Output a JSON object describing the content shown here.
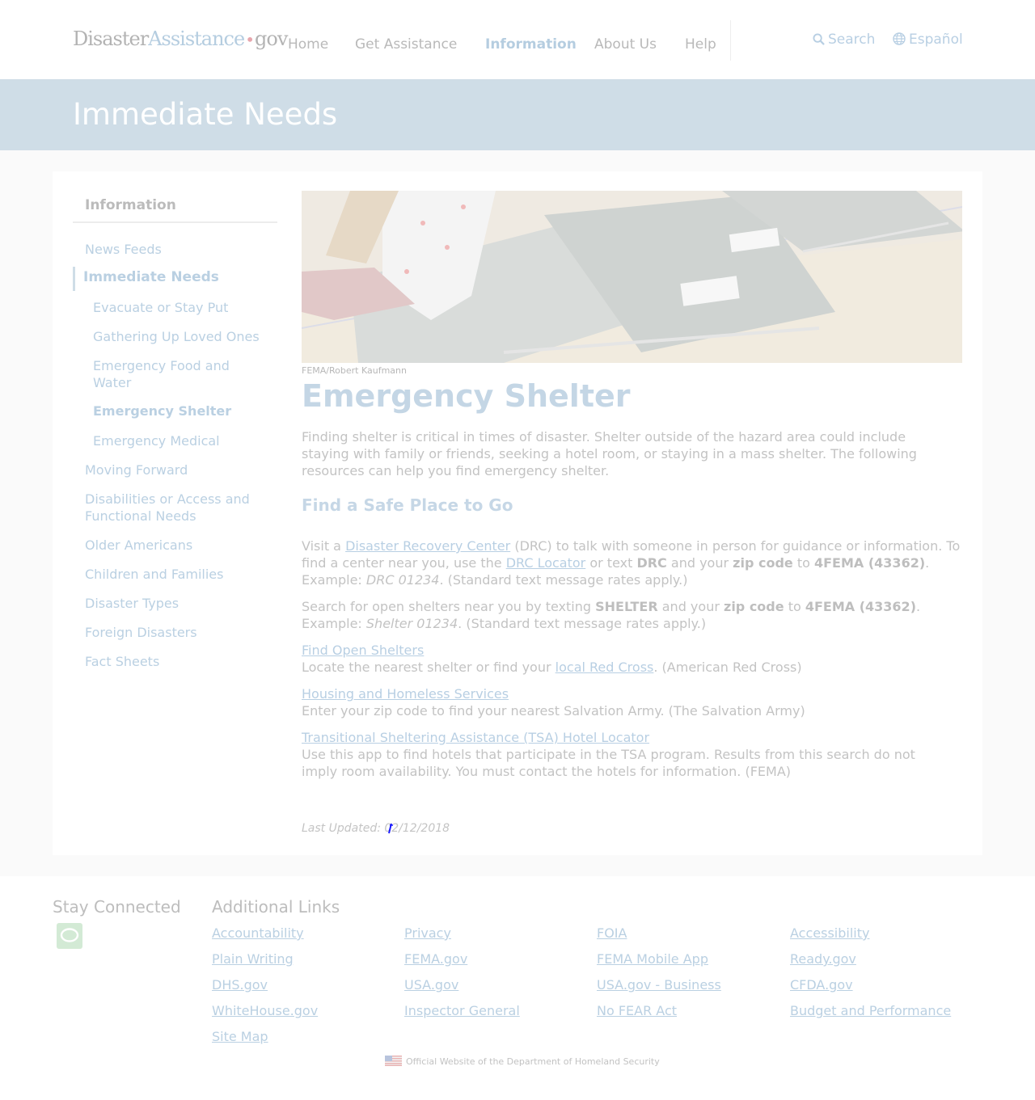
{
  "header": {
    "logo": {
      "part1": "Disaster",
      "part2": "Assistance",
      "dot": "•",
      "part3": "gov"
    },
    "nav": [
      "Home",
      "Get Assistance",
      "Information",
      "About Us",
      "Help"
    ],
    "active_nav": "Information",
    "search_label": "Search",
    "language_label": "Español"
  },
  "banner": {
    "title": "Immediate Needs"
  },
  "sidebar": {
    "title": "Information",
    "items": [
      "News Feeds",
      "Immediate Needs",
      "Evacuate or Stay Put",
      "Gathering Up Loved Ones",
      "Emergency Food and Water",
      "Emergency Shelter",
      "Emergency Medical",
      "Moving Forward",
      "Disabilities or Access and Functional Needs",
      "Older Americans",
      "Children and Families",
      "Disaster Types",
      "Foreign Disasters",
      "Fact Sheets"
    ]
  },
  "content": {
    "photo_credit": "FEMA/Robert Kaufmann",
    "heading": "Emergency Shelter",
    "intro": "Finding shelter is critical in times of disaster. Shelter outside of the hazard area could include staying with family or friends, seeking a hotel room, or staying in a mass shelter. The following resources can help you find emergency shelter.",
    "subheading": "Find a Safe Place to Go",
    "drc": {
      "t1": "Visit a ",
      "link1": "Disaster Recovery Center",
      "t2": " (DRC) to talk with someone in person for guidance or information. To find a center near you, use the ",
      "link2": "DRC Locator",
      "t3": " or text ",
      "b1": "DRC",
      "t4": " and your ",
      "b2": "zip code",
      "t5": " to ",
      "b3": "4FEMA (43362)",
      "t6": ". Example: ",
      "ex": "DRC 01234",
      "t7": ". (Standard text message rates apply.)"
    },
    "shelter_text": {
      "t1": "Search for open shelters near you by texting ",
      "b1": "SHELTER",
      "t2": " and your ",
      "b2": "zip code",
      "t3": " to ",
      "b3": "4FEMA (43362)",
      "t4": ". Example: ",
      "ex": "Shelter 01234",
      "t5": ". (Standard text message rates apply.)"
    },
    "resources": [
      {
        "link": "Find Open Shelters",
        "d1": "Locate the nearest shelter or find your ",
        "dlink": "local Red Cross",
        "d2": ". (American Red Cross)"
      },
      {
        "link": "Housing and Homeless Services",
        "desc": "Enter your zip code to find your nearest Salvation Army. (The Salvation Army)"
      },
      {
        "link": "Transitional Sheltering Assistance (TSA) Hotel Locator",
        "desc": "Use this app to find hotels that participate in the TSA program. Results from this search do not imply room availability. You must contact the hotels for information. (FEMA)"
      }
    ],
    "last_updated": "Last Updated: 02/12/2018"
  },
  "footer": {
    "stay_connected": "Stay Connected",
    "additional_links": "Additional Links",
    "links": [
      [
        "Accountability",
        "Privacy",
        "FOIA",
        "Accessibility"
      ],
      [
        "Plain Writing",
        "FEMA.gov",
        "FEMA Mobile App",
        "Ready.gov"
      ],
      [
        "DHS.gov",
        "USA.gov",
        "USA.gov - Business",
        "CFDA.gov"
      ],
      [
        "WhiteHouse.gov",
        "Inspector General",
        "No FEAR Act",
        "Budget and Performance"
      ],
      [
        "Site Map"
      ]
    ],
    "official": "Official Website of the Department of Homeland Security"
  },
  "colors": {
    "banner": "#cfdde7",
    "link": "#b8cfe3",
    "text": "#c3c3c3"
  },
  "icons": [
    "search-icon",
    "globe-icon",
    "chat-icon",
    "us-flag-icon"
  ]
}
